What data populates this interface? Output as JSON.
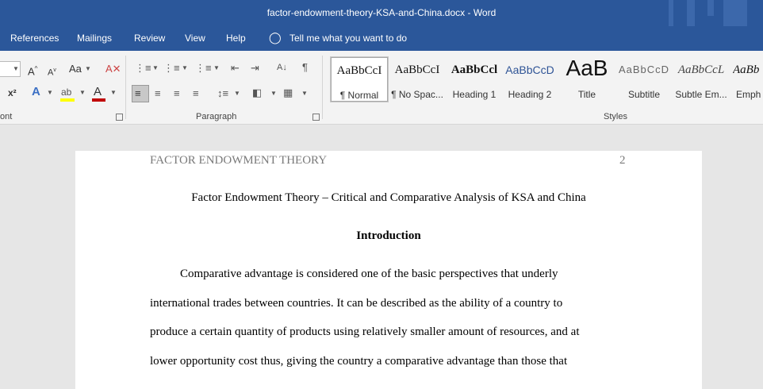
{
  "window": {
    "title": "factor-endowment-theory-KSA-and-China.docx  -  Word"
  },
  "menu": {
    "items": [
      "References",
      "Mailings",
      "Review",
      "View",
      "Help"
    ],
    "tell_me": "Tell me what you want to do"
  },
  "ribbon": {
    "font_group_label": "ont",
    "paragraph_group_label": "Paragraph",
    "styles_group_label": "Styles",
    "font_size_glyph": "Aa",
    "superscript_glyph": "x²",
    "styles": [
      {
        "preview": "AaBbCcI",
        "name": "¶ Normal"
      },
      {
        "preview": "AaBbCcI",
        "name": "¶ No Spac..."
      },
      {
        "preview": "AaBbCcl",
        "name": "Heading 1"
      },
      {
        "preview": "AaBbCcD",
        "name": "Heading 2"
      },
      {
        "preview": "AaB",
        "name": "Title"
      },
      {
        "preview": "AaBbCcD",
        "name": "Subtitle"
      },
      {
        "preview": "AaBbCcL",
        "name": "Subtle Em..."
      },
      {
        "preview": "AaBb",
        "name": "Emph"
      }
    ]
  },
  "document": {
    "running_head": "FACTOR ENDOWMENT THEORY",
    "page_number": "2",
    "title": "Factor Endowment Theory – Critical and Comparative Analysis of KSA and China",
    "section_heading": "Introduction",
    "body_lines": [
      "Comparative advantage is considered one of the basic perspectives that underly",
      "international trades between countries. It can be described as the ability of a country to",
      "produce a certain quantity of products using relatively smaller amount of resources, and at",
      "lower opportunity cost thus, giving the country a comparative advantage than those that"
    ]
  }
}
